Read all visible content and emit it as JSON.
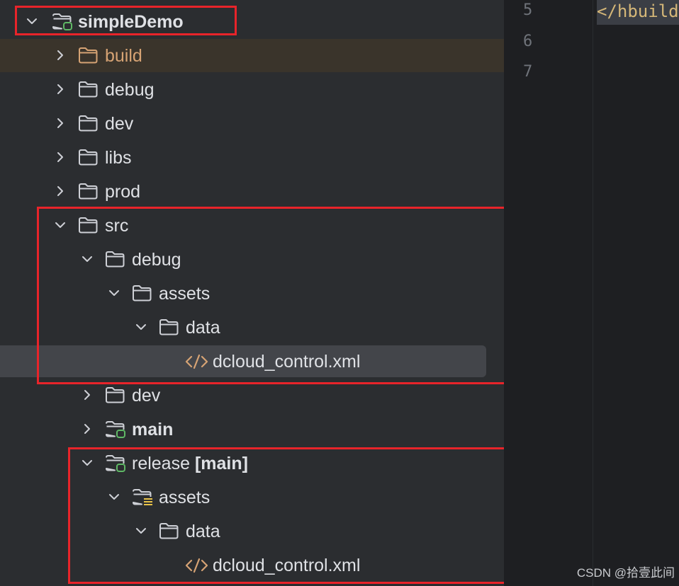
{
  "project_tree": {
    "root": "simpleDemo",
    "folders": {
      "build": "build",
      "debug": "debug",
      "dev": "dev",
      "libs": "libs",
      "prod": "prod",
      "src": "src",
      "src_debug": "debug",
      "src_debug_assets": "assets",
      "src_debug_assets_data": "data",
      "src_debug_file": "dcloud_control.xml",
      "src_dev": "dev",
      "src_main": "main",
      "src_release": "release",
      "src_release_badge": "[main]",
      "src_release_assets": "assets",
      "src_release_assets_data": "data",
      "src_release_file": "dcloud_control.xml"
    }
  },
  "editor": {
    "line_numbers": [
      "5",
      "6",
      "7"
    ],
    "code_line_5": "</hbuild"
  },
  "watermark": "CSDN @拾壹此间",
  "colors": {
    "highlight_box": "#e8242a",
    "build_folder_text": "#d6a374",
    "selected_row": "#43454a"
  },
  "icons": {
    "chevron_expanded": "chevron-down-icon",
    "chevron_collapsed": "chevron-right-icon",
    "folder": "folder-icon",
    "module_folder": "module-folder-icon",
    "resources_folder": "resources-folder-icon",
    "xml_file": "xml-file-icon"
  }
}
